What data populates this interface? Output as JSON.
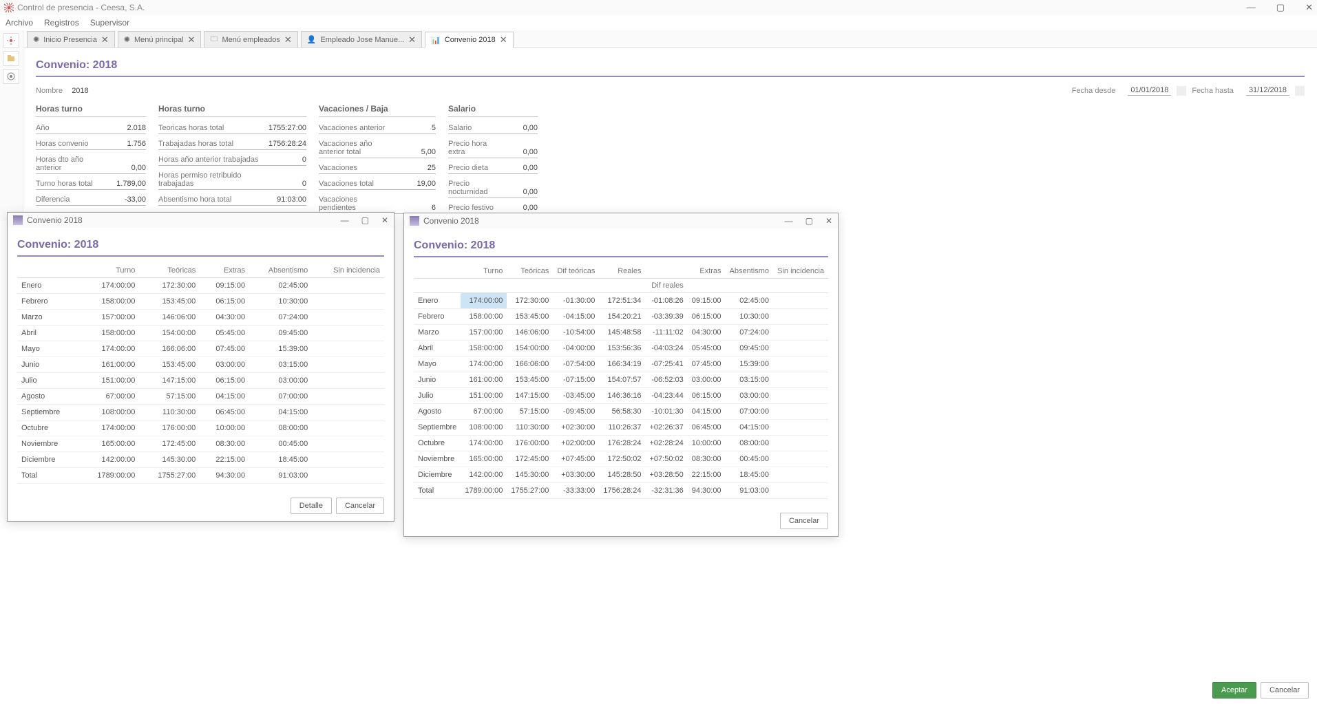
{
  "app": {
    "title": "Control de presencia - Ceesa, S.A."
  },
  "menu": [
    "Archivo",
    "Registros",
    "Supervisor"
  ],
  "tabs": [
    {
      "label": "Inicio Presencia",
      "icon": "app"
    },
    {
      "label": "Menú principal",
      "icon": "app"
    },
    {
      "label": "Menú empleados",
      "icon": "folder"
    },
    {
      "label": "Empleado  Jose Manue...",
      "icon": "user"
    },
    {
      "label": "Convenio 2018",
      "icon": "chart",
      "active": true
    }
  ],
  "page": {
    "title": "Convenio: 2018",
    "nombre_label": "Nombre",
    "nombre_value": "2018",
    "fecha_desde_label": "Fecha desde",
    "fecha_desde": "01/01/2018",
    "fecha_hasta_label": "Fecha hasta",
    "fecha_hasta": "31/12/2018"
  },
  "panels": {
    "p1": {
      "title": "Horas turno",
      "rows": [
        {
          "l": "Año",
          "v": "2.018"
        },
        {
          "l": "Horas convenio",
          "v": "1.756"
        },
        {
          "l": "Horas dto año anterior",
          "v": "0,00"
        },
        {
          "l": "Turno horas total",
          "v": "1.789,00"
        },
        {
          "l": "Diferencia",
          "v": "-33,00"
        }
      ]
    },
    "p2": {
      "title": "Horas turno",
      "rows": [
        {
          "l": "Teoricas horas total",
          "v": "1755:27:00"
        },
        {
          "l": "Trabajadas horas total",
          "v": "1756:28:24"
        },
        {
          "l": "Horas año anterior trabajadas",
          "v": "0"
        },
        {
          "l": "Horas permiso retribuido trabajadas",
          "v": "0"
        },
        {
          "l": "Absentismo hora total",
          "v": "91:03:00"
        }
      ]
    },
    "p3": {
      "title": "Vacaciones / Baja",
      "rows": [
        {
          "l": "Vacaciones anterior",
          "v": "5"
        },
        {
          "l": "Vacaciones año anterior total",
          "v": "5,00"
        },
        {
          "l": "Vacaciones",
          "v": "25"
        },
        {
          "l": "Vacaciones total",
          "v": "19,00"
        },
        {
          "l": "Vacaciones pendientes",
          "v": "6"
        }
      ]
    },
    "p4": {
      "title": "Salario",
      "rows": [
        {
          "l": "Salario",
          "v": "0,00"
        },
        {
          "l": "Precio hora extra",
          "v": "0,00"
        },
        {
          "l": "Precio dieta",
          "v": "0,00"
        },
        {
          "l": "Precio nocturnidad",
          "v": "0,00"
        },
        {
          "l": "Precio festivo",
          "v": "0,00"
        }
      ]
    }
  },
  "dlg1": {
    "win_title": "Convenio 2018",
    "title": "Convenio: 2018",
    "cols": [
      "",
      "Turno",
      "Teóricas",
      "Extras",
      "Absentismo",
      "Sin incidencia"
    ],
    "rows": [
      [
        "Enero",
        "174:00:00",
        "172:30:00",
        "09:15:00",
        "02:45:00",
        ""
      ],
      [
        "Febrero",
        "158:00:00",
        "153:45:00",
        "06:15:00",
        "10:30:00",
        ""
      ],
      [
        "Marzo",
        "157:00:00",
        "146:06:00",
        "04:30:00",
        "07:24:00",
        ""
      ],
      [
        "Abril",
        "158:00:00",
        "154:00:00",
        "05:45:00",
        "09:45:00",
        ""
      ],
      [
        "Mayo",
        "174:00:00",
        "166:06:00",
        "07:45:00",
        "15:39:00",
        ""
      ],
      [
        "Junio",
        "161:00:00",
        "153:45:00",
        "03:00:00",
        "03:15:00",
        ""
      ],
      [
        "Julio",
        "151:00:00",
        "147:15:00",
        "06:15:00",
        "03:00:00",
        ""
      ],
      [
        "Agosto",
        "67:00:00",
        "57:15:00",
        "04:15:00",
        "07:00:00",
        ""
      ],
      [
        "Septiembre",
        "108:00:00",
        "110:30:00",
        "06:45:00",
        "04:15:00",
        ""
      ],
      [
        "Octubre",
        "174:00:00",
        "176:00:00",
        "10:00:00",
        "08:00:00",
        ""
      ],
      [
        "Noviembre",
        "165:00:00",
        "172:45:00",
        "08:30:00",
        "00:45:00",
        ""
      ],
      [
        "Diciembre",
        "142:00:00",
        "145:30:00",
        "22:15:00",
        "18:45:00",
        ""
      ],
      [
        "Total",
        "1789:00:00",
        "1755:27:00",
        "94:30:00",
        "91:03:00",
        ""
      ]
    ],
    "btn_detail": "Detalle",
    "btn_cancel": "Cancelar"
  },
  "dlg2": {
    "win_title": "Convenio 2018",
    "title": "Convenio: 2018",
    "cols_top": [
      "",
      "Turno",
      "Teóricas",
      "Dif teóricas",
      "Reales",
      "",
      "Extras",
      "Absentismo",
      "Sin incidencia"
    ],
    "dif_reales_label": "Dif reales",
    "rows": [
      [
        "Enero",
        "174:00:00",
        "172:30:00",
        "-01:30:00",
        "172:51:34",
        "-01:08:26",
        "09:15:00",
        "02:45:00",
        ""
      ],
      [
        "Febrero",
        "158:00:00",
        "153:45:00",
        "-04:15:00",
        "154:20:21",
        "-03:39:39",
        "06:15:00",
        "10:30:00",
        ""
      ],
      [
        "Marzo",
        "157:00:00",
        "146:06:00",
        "-10:54:00",
        "145:48:58",
        "-11:11:02",
        "04:30:00",
        "07:24:00",
        ""
      ],
      [
        "Abril",
        "158:00:00",
        "154:00:00",
        "-04:00:00",
        "153:56:36",
        "-04:03:24",
        "05:45:00",
        "09:45:00",
        ""
      ],
      [
        "Mayo",
        "174:00:00",
        "166:06:00",
        "-07:54:00",
        "166:34:19",
        "-07:25:41",
        "07:45:00",
        "15:39:00",
        ""
      ],
      [
        "Junio",
        "161:00:00",
        "153:45:00",
        "-07:15:00",
        "154:07:57",
        "-06:52:03",
        "03:00:00",
        "03:15:00",
        ""
      ],
      [
        "Julio",
        "151:00:00",
        "147:15:00",
        "-03:45:00",
        "146:36:16",
        "-04:23:44",
        "06:15:00",
        "03:00:00",
        ""
      ],
      [
        "Agosto",
        "67:00:00",
        "57:15:00",
        "-09:45:00",
        "56:58:30",
        "-10:01:30",
        "04:15:00",
        "07:00:00",
        ""
      ],
      [
        "Septiembre",
        "108:00:00",
        "110:30:00",
        "+02:30:00",
        "110:26:37",
        "+02:26:37",
        "06:45:00",
        "04:15:00",
        ""
      ],
      [
        "Octubre",
        "174:00:00",
        "176:00:00",
        "+02:00:00",
        "176:28:24",
        "+02:28:24",
        "10:00:00",
        "08:00:00",
        ""
      ],
      [
        "Noviembre",
        "165:00:00",
        "172:45:00",
        "+07:45:00",
        "172:50:02",
        "+07:50:02",
        "08:30:00",
        "00:45:00",
        ""
      ],
      [
        "Diciembre",
        "142:00:00",
        "145:30:00",
        "+03:30:00",
        "145:28:50",
        "+03:28:50",
        "22:15:00",
        "18:45:00",
        ""
      ],
      [
        "Total",
        "1789:00:00",
        "1755:27:00",
        "-33:33:00",
        "1756:28:24",
        "-32:31:36",
        "94:30:00",
        "91:03:00",
        ""
      ]
    ],
    "btn_cancel": "Cancelar"
  },
  "footer": {
    "accept": "Aceptar",
    "cancel": "Cancelar"
  }
}
